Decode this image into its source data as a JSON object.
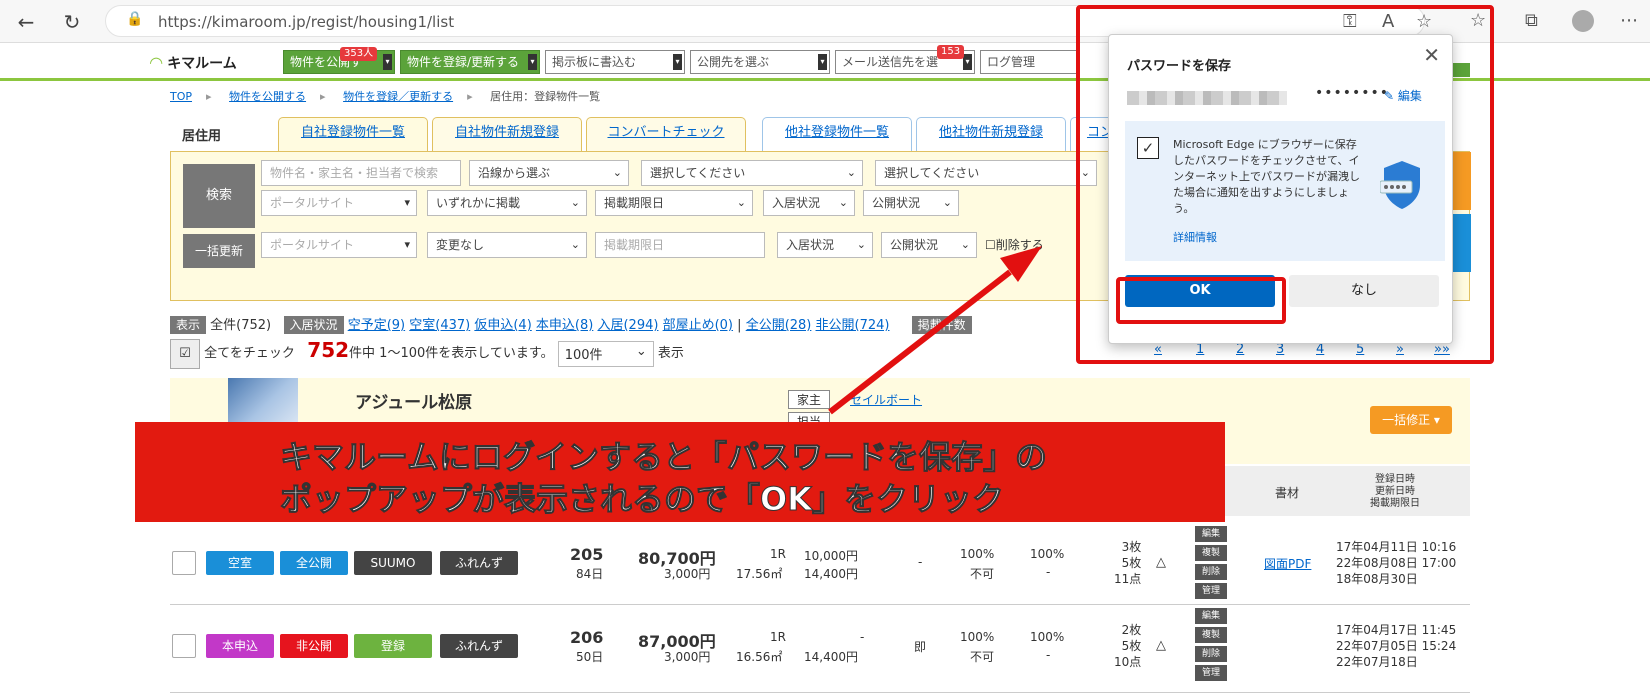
{
  "browser": {
    "url": "https://kimaroom.jp/regist/housing1/list"
  },
  "nav": {
    "logo": "キマルーム",
    "publish": "物件を公開す",
    "publish_badge": "353人",
    "register": "物件を登録/更新する",
    "board": "掲示板に書込む",
    "select_pub": "公開先を選ぶ",
    "mail": "メール送信先を選",
    "mail_badge": "153",
    "log": "ログ管理"
  },
  "breadcrumb": {
    "top": "TOP",
    "publish": "物件を公開する",
    "register": "物件を登録／更新する",
    "current": "居住用：登録物件一覧"
  },
  "tabs": {
    "section": "居住用",
    "items": [
      "自社登録物件一覧",
      "自社物件新規登録",
      "コンバートチェック",
      "他社登録物件一覧",
      "他社物件新規登録",
      "コン"
    ]
  },
  "search": {
    "label": "検索",
    "name_placeholder": "物件名・家主名・担当者で検索",
    "line": "沿線から選ぶ",
    "select1": "選択してください",
    "select2": "選択してください",
    "portal": "ポータルサイト",
    "any_listing": "いずれかに掲載",
    "deadline": "掲載期限日",
    "move_status": "入居状況",
    "pub_status": "公開状況"
  },
  "bulk": {
    "label": "一括更新",
    "portal": "ポータルサイト",
    "change": "変更なし",
    "deadline": "掲載期限日",
    "move_status": "入居状況",
    "pub_status": "公開状況",
    "delete": "削除する"
  },
  "status": {
    "display": "表示",
    "all": "全件(752)",
    "move": "入居状況",
    "links": [
      "空予定(9)",
      "空室(437)",
      "仮申込(4)",
      "本申込(8)",
      "入居(294)",
      "部屋止め(0)"
    ],
    "sep": "|",
    "pub_links": [
      "全公開(28)",
      "非公開(724)"
    ],
    "extra": "掲載件数"
  },
  "count": {
    "check_all": "全てをチェック",
    "num": "752",
    "text": "件中 1～100件を表示しています。",
    "per_page": "100件",
    "show": "表示"
  },
  "pager": [
    "«",
    "1",
    "2",
    "3",
    "4",
    "5",
    "»",
    "»»"
  ],
  "property": {
    "name": "アジュール松原",
    "owner_tag": "家主",
    "link": "セイルボート",
    "staff_tag": "担当",
    "fix": "一括修正"
  },
  "headers": {
    "material": "書材",
    "dates": [
      "登録日時",
      "更新日時",
      "掲載期限日"
    ]
  },
  "rows": [
    {
      "tags": [
        "空室",
        "全公開",
        "SUUMO",
        "ふれんず"
      ],
      "room": "205",
      "days": "84日",
      "rent": "80,700円",
      "fee": "3,000円",
      "layout": "1R",
      "area": "17.56㎡",
      "deposit": "10,000円",
      "key": "14,400円",
      "dash": "-",
      "ad1": "100%",
      "ad1b": "不可",
      "ad2": "100%",
      "ad2b": "-",
      "photos": [
        "3枚",
        "5枚",
        "11点"
      ],
      "tri": "△",
      "mini": [
        "編集",
        "複製",
        "削除",
        "管理"
      ],
      "pdf": "図面PDF",
      "dates": [
        "17年04月11日 10:16",
        "22年08月08日 17:00",
        "18年08月30日"
      ]
    },
    {
      "tags": [
        "本申込",
        "非公開",
        "登録",
        "ふれんず"
      ],
      "room": "206",
      "days": "50日",
      "rent": "87,000円",
      "fee": "3,000円",
      "layout": "1R",
      "area": "16.56㎡",
      "deposit": "-",
      "key": "14,400円",
      "dash": "即",
      "ad1": "100%",
      "ad1b": "不可",
      "ad2": "100%",
      "ad2b": "-",
      "photos": [
        "2枚",
        "5枚",
        "10点"
      ],
      "tri": "△",
      "mini": [
        "編集",
        "複製",
        "削除",
        "管理"
      ],
      "pdf": "",
      "dates": [
        "17年04月17日 11:45",
        "22年07月05日 15:24",
        "22年07月18日"
      ]
    }
  ],
  "popup": {
    "title": "パスワードを保存",
    "dots": "••••••••",
    "edit": "編集",
    "info": "Microsoft Edge にブラウザーに保存したパスワードをチェックさせて、インターネット上でパスワードが漏洩した場合に通知を出すようにしましょう。",
    "more": "詳細情報",
    "ok": "OK",
    "no": "なし"
  },
  "banner": {
    "line1": "キマルームにログインすると「パスワードを保存」の",
    "line2": "ポップアップが表示されるので「OK」をクリック"
  },
  "colors": {
    "accent_red": "#e21a10",
    "edge_blue": "#0067c0",
    "kima_green": "#8cc63f",
    "tag_blue": "#1a8fd8",
    "tag_magenta": "#c238c8",
    "tag_red": "#e6141e",
    "tag_green": "#6db33f",
    "tag_dark": "#444444"
  }
}
